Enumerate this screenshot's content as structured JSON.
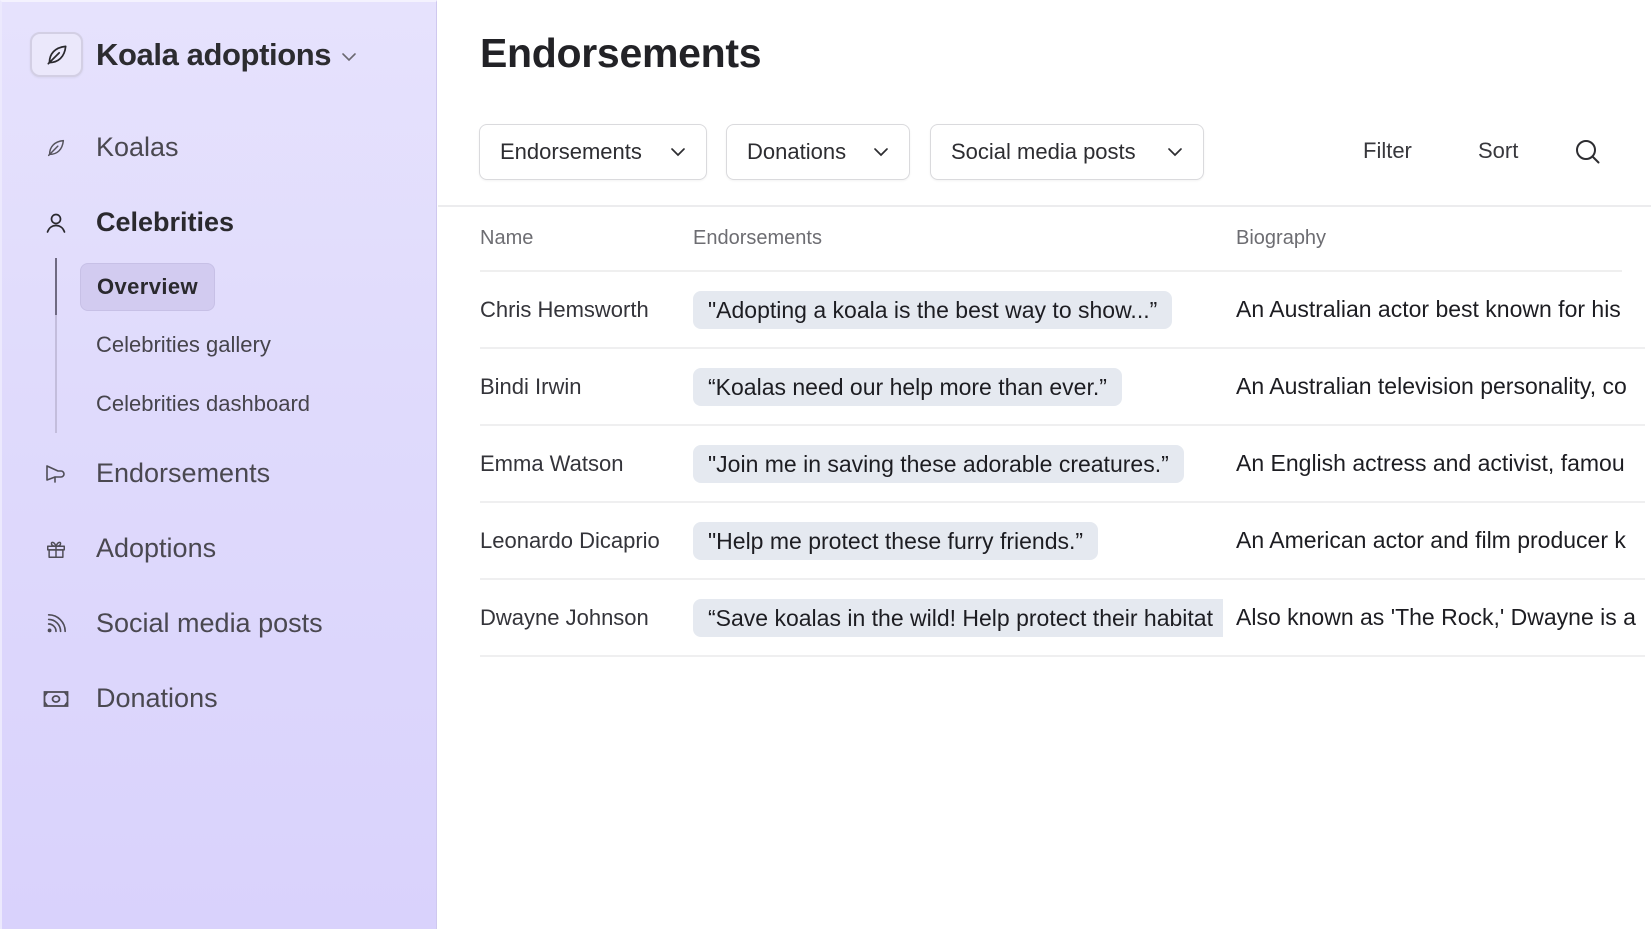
{
  "sidebar": {
    "brand": {
      "name": "Koala adoptions",
      "icon": "leaf-icon"
    },
    "items": [
      {
        "label": "Koalas",
        "icon": "leaf-icon",
        "active": false
      },
      {
        "label": "Celebrities",
        "icon": "user-icon",
        "active": true,
        "children": [
          {
            "label": "Overview",
            "active": true
          },
          {
            "label": "Celebrities gallery",
            "active": false
          },
          {
            "label": "Celebrities dashboard",
            "active": false
          }
        ]
      },
      {
        "label": "Endorsements",
        "icon": "megaphone-icon",
        "active": false
      },
      {
        "label": "Adoptions",
        "icon": "gift-icon",
        "active": false
      },
      {
        "label": "Social media posts",
        "icon": "rss-icon",
        "active": false
      },
      {
        "label": "Donations",
        "icon": "banknote-icon",
        "active": false
      }
    ]
  },
  "main": {
    "title": "Endorsements",
    "dropdowns": [
      {
        "label": "Endorsements"
      },
      {
        "label": "Donations"
      },
      {
        "label": "Social media posts"
      }
    ],
    "toolbar": {
      "filter_label": "Filter",
      "sort_label": "Sort",
      "search_icon": "search-icon"
    },
    "table": {
      "columns": [
        "Name",
        "Endorsements",
        "Biography"
      ],
      "rows": [
        {
          "name": "Chris Hemsworth",
          "endorsement": "\"Adopting a koala is the best way to show...”",
          "biography": "An Australian actor best known for his"
        },
        {
          "name": "Bindi Irwin",
          "endorsement": "“Koalas need our help more than ever.”",
          "biography": "An Australian television personality, co"
        },
        {
          "name": "Emma Watson",
          "endorsement": "\"Join me in saving these adorable creatures.”",
          "biography": "An English actress and activist, famou"
        },
        {
          "name": "Leonardo Dicaprio",
          "endorsement": "\"Help me protect these furry friends.”",
          "biography": "An American actor and film producer k"
        },
        {
          "name": "Dwayne Johnson",
          "endorsement": "“Save koalas in the wild! Help protect their habitat",
          "biography": "Also known as 'The Rock,' Dwayne is a"
        }
      ]
    }
  },
  "colors": {
    "sidebar_bg_top": "#e6e2fd",
    "sidebar_bg_bottom": "#d9d2fc",
    "active_subitem_bg": "#d2cbf0",
    "endorsement_pill_bg": "#e5e9f0"
  }
}
